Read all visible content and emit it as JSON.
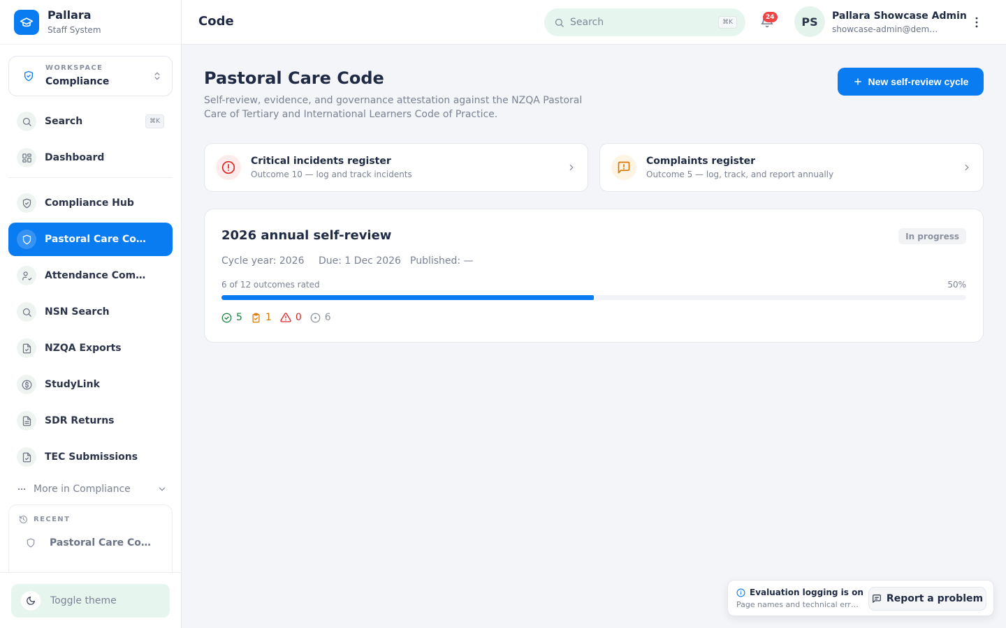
{
  "brand": {
    "name": "Pallara",
    "subtitle": "Staff System"
  },
  "workspace": {
    "caption": "WORKSPACE",
    "value": "Compliance"
  },
  "sidebar": {
    "search": {
      "label": "Search",
      "shortcut": "⌘K"
    },
    "items": [
      {
        "label": "Dashboard",
        "icon": "grid-icon"
      },
      {
        "label": "Compliance Hub",
        "icon": "shield-check-icon"
      },
      {
        "label": "Pastoral Care Code",
        "icon": "shield-icon",
        "active": true
      },
      {
        "label": "Attendance Comp…",
        "icon": "user-check-icon"
      },
      {
        "label": "NSN Search",
        "icon": "search-icon"
      },
      {
        "label": "NZQA Exports",
        "icon": "file-check-icon"
      },
      {
        "label": "StudyLink",
        "icon": "dollar-icon"
      },
      {
        "label": "SDR Returns",
        "icon": "file-text-icon"
      },
      {
        "label": "TEC Submissions",
        "icon": "file-check-icon"
      }
    ],
    "more_label": "More in Compliance",
    "recent": {
      "caption": "RECENT",
      "items": [
        {
          "label": "Pastoral Care Co…"
        }
      ]
    },
    "toggle_theme": "Toggle theme"
  },
  "header": {
    "title": "Code",
    "search_placeholder": "Search",
    "search_shortcut": "⌘K",
    "notifications_count": "24",
    "user": {
      "initials": "PS",
      "name": "Pallara Showcase Admin",
      "email": "showcase-admin@dem…"
    }
  },
  "page": {
    "title": "Pastoral Care Code",
    "description": "Self-review, evidence, and governance attestation against the NZQA Pastoral Care of Tertiary and International Learners Code of Practice.",
    "new_button": "New self-review cycle"
  },
  "registers": [
    {
      "title": "Critical incidents register",
      "subtitle": "Outcome 10 — log and track incidents",
      "icon": "alert-circle-icon",
      "color": "#dc2626"
    },
    {
      "title": "Complaints register",
      "subtitle": "Outcome 5 — log, track, and report annually",
      "icon": "message-alert-icon",
      "color": "#d97706"
    }
  ],
  "cycle": {
    "title": "2026 annual self-review",
    "status": "In progress",
    "cycle_year": "Cycle year: 2026",
    "due": "Due: 1 Dec 2026",
    "published": "Published: —",
    "rated_text": "6 of 12 outcomes rated",
    "percent_text": "50%",
    "progress": 0.5,
    "counts": [
      {
        "value": "5",
        "icon": "check-circle-icon",
        "color": "#15803d"
      },
      {
        "value": "1",
        "icon": "clipboard-check-icon",
        "color": "#d97706"
      },
      {
        "value": "0",
        "icon": "alert-triangle-icon",
        "color": "#dc2626"
      },
      {
        "value": "6",
        "icon": "circle-dot-icon",
        "color": "#8a92a2"
      }
    ]
  },
  "toast": {
    "title": "Evaluation logging is on",
    "subtitle": "Page names and technical err…",
    "button": "Report a problem"
  },
  "colors": {
    "accent": "#0a7cf2",
    "mint": "#e7f5ef"
  }
}
